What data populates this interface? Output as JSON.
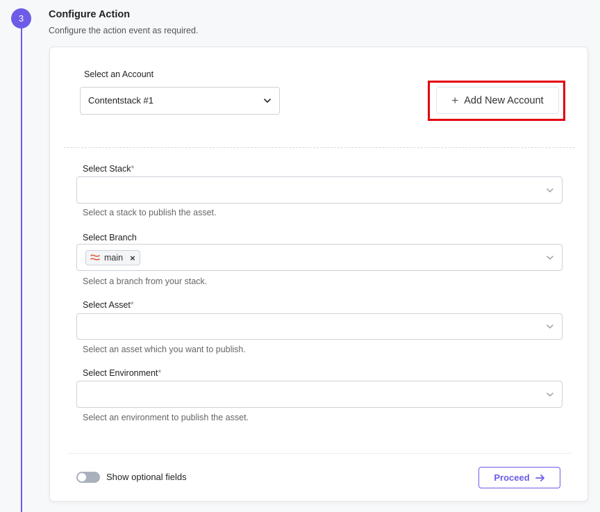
{
  "step": {
    "number": "3",
    "title": "Configure Action",
    "subtitle": "Configure the action event as required."
  },
  "account": {
    "label": "Select an Account",
    "selected": "Contentstack #1",
    "add_button": "Add New Account"
  },
  "fields": {
    "stack": {
      "label": "Select Stack",
      "required_mark": "*",
      "hint": "Select a stack to publish the asset."
    },
    "branch": {
      "label": "Select Branch",
      "tag": "main",
      "hint": "Select a branch from your stack."
    },
    "asset": {
      "label": "Select Asset",
      "required_mark": "*",
      "hint": "Select an asset which you want to publish."
    },
    "environment": {
      "label": "Select Environment",
      "required_mark": "*",
      "hint": "Select an environment to publish the asset."
    }
  },
  "footer": {
    "toggle_label": "Show optional fields",
    "proceed": "Proceed"
  },
  "colors": {
    "accent": "#6c5ce7",
    "highlight_frame": "#e3000f"
  }
}
